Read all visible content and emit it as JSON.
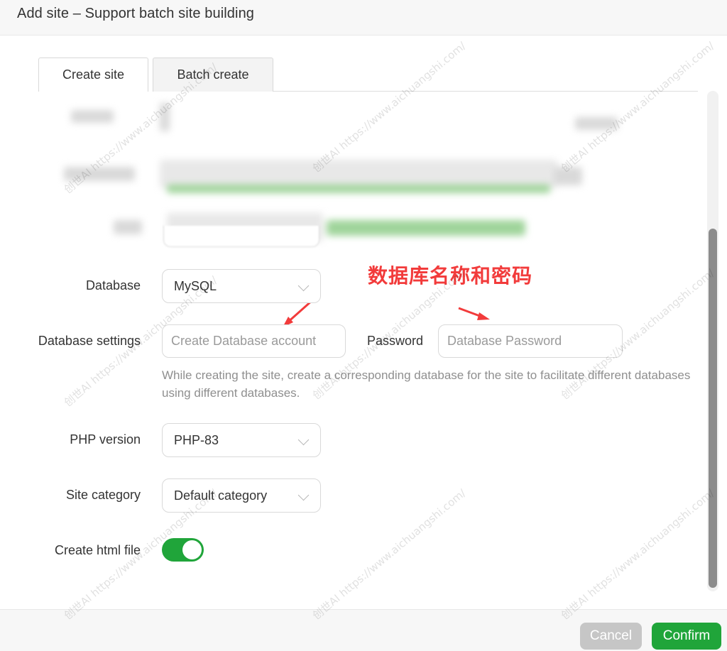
{
  "window": {
    "title": "Add site – Support batch site building"
  },
  "tabs": [
    {
      "label": "Create site",
      "active": true
    },
    {
      "label": "Batch create",
      "active": false
    }
  ],
  "annotation": {
    "text": "数据库名称和密码"
  },
  "form": {
    "database": {
      "label": "Database",
      "value": "MySQL"
    },
    "database_settings": {
      "label": "Database settings",
      "account_placeholder": "Create Database account",
      "password_label": "Password",
      "password_placeholder": "Database Password",
      "help": "While creating the site, create a corresponding database for the site to facilitate different databases using different databases."
    },
    "php_version": {
      "label": "PHP version",
      "value": "PHP-83"
    },
    "site_category": {
      "label": "Site category",
      "value": "Default category"
    },
    "create_html": {
      "label": "Create html file",
      "on": true
    }
  },
  "footer": {
    "cancel_label": "Cancel",
    "confirm_label": "Confirm"
  },
  "watermark": {
    "text": "https://www.aichuangshi.com/",
    "brand": "创世AI"
  },
  "colors": {
    "accent": "#20a53a",
    "annotation": "#f23b3b",
    "cancel": "#c6c6c6"
  },
  "icons": [
    "chevron-down-icon",
    "arrow-icon"
  ]
}
